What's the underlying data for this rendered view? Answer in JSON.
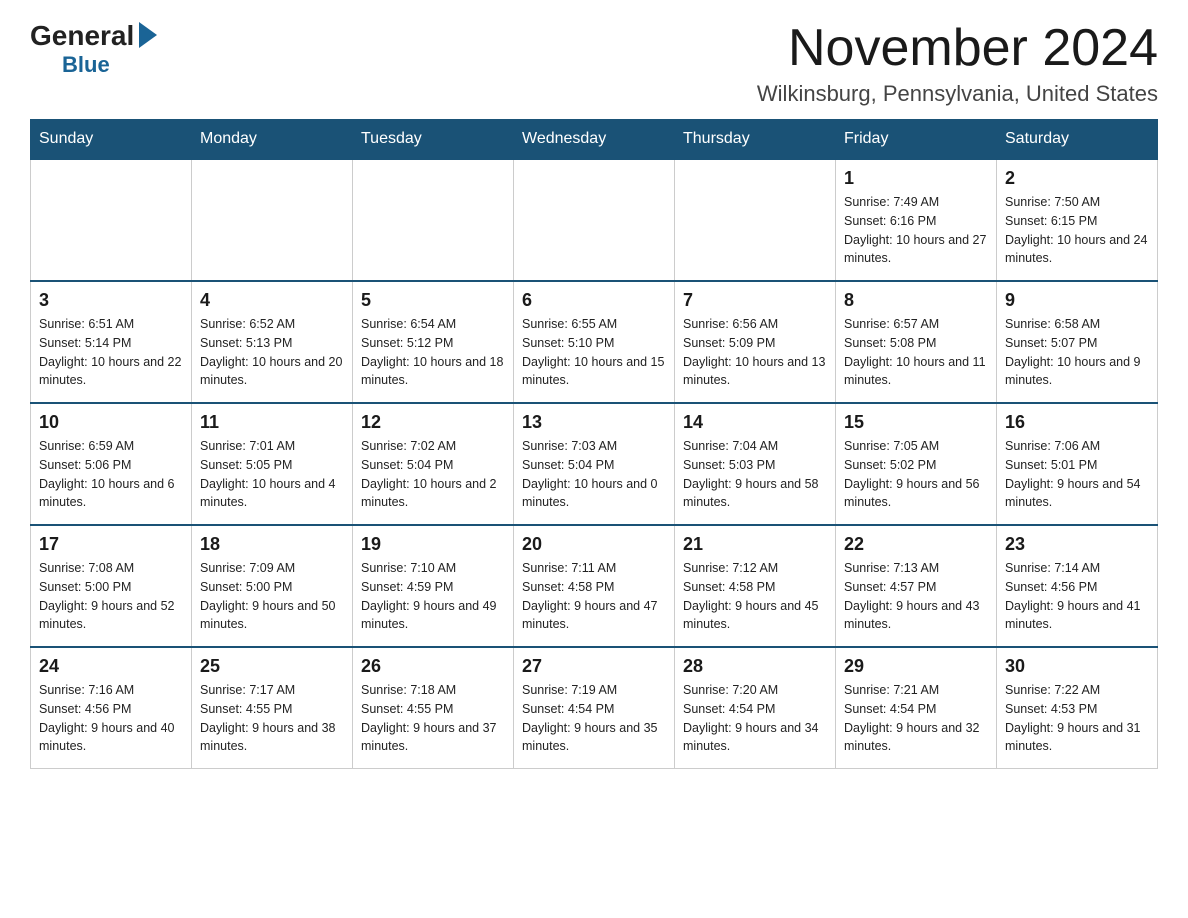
{
  "header": {
    "logo_text_general": "General",
    "logo_text_blue": "Blue",
    "month_year": "November 2024",
    "location": "Wilkinsburg, Pennsylvania, United States"
  },
  "weekdays": [
    "Sunday",
    "Monday",
    "Tuesday",
    "Wednesday",
    "Thursday",
    "Friday",
    "Saturday"
  ],
  "weeks": [
    [
      {
        "day": "",
        "info": ""
      },
      {
        "day": "",
        "info": ""
      },
      {
        "day": "",
        "info": ""
      },
      {
        "day": "",
        "info": ""
      },
      {
        "day": "",
        "info": ""
      },
      {
        "day": "1",
        "info": "Sunrise: 7:49 AM\nSunset: 6:16 PM\nDaylight: 10 hours and 27 minutes."
      },
      {
        "day": "2",
        "info": "Sunrise: 7:50 AM\nSunset: 6:15 PM\nDaylight: 10 hours and 24 minutes."
      }
    ],
    [
      {
        "day": "3",
        "info": "Sunrise: 6:51 AM\nSunset: 5:14 PM\nDaylight: 10 hours and 22 minutes."
      },
      {
        "day": "4",
        "info": "Sunrise: 6:52 AM\nSunset: 5:13 PM\nDaylight: 10 hours and 20 minutes."
      },
      {
        "day": "5",
        "info": "Sunrise: 6:54 AM\nSunset: 5:12 PM\nDaylight: 10 hours and 18 minutes."
      },
      {
        "day": "6",
        "info": "Sunrise: 6:55 AM\nSunset: 5:10 PM\nDaylight: 10 hours and 15 minutes."
      },
      {
        "day": "7",
        "info": "Sunrise: 6:56 AM\nSunset: 5:09 PM\nDaylight: 10 hours and 13 minutes."
      },
      {
        "day": "8",
        "info": "Sunrise: 6:57 AM\nSunset: 5:08 PM\nDaylight: 10 hours and 11 minutes."
      },
      {
        "day": "9",
        "info": "Sunrise: 6:58 AM\nSunset: 5:07 PM\nDaylight: 10 hours and 9 minutes."
      }
    ],
    [
      {
        "day": "10",
        "info": "Sunrise: 6:59 AM\nSunset: 5:06 PM\nDaylight: 10 hours and 6 minutes."
      },
      {
        "day": "11",
        "info": "Sunrise: 7:01 AM\nSunset: 5:05 PM\nDaylight: 10 hours and 4 minutes."
      },
      {
        "day": "12",
        "info": "Sunrise: 7:02 AM\nSunset: 5:04 PM\nDaylight: 10 hours and 2 minutes."
      },
      {
        "day": "13",
        "info": "Sunrise: 7:03 AM\nSunset: 5:04 PM\nDaylight: 10 hours and 0 minutes."
      },
      {
        "day": "14",
        "info": "Sunrise: 7:04 AM\nSunset: 5:03 PM\nDaylight: 9 hours and 58 minutes."
      },
      {
        "day": "15",
        "info": "Sunrise: 7:05 AM\nSunset: 5:02 PM\nDaylight: 9 hours and 56 minutes."
      },
      {
        "day": "16",
        "info": "Sunrise: 7:06 AM\nSunset: 5:01 PM\nDaylight: 9 hours and 54 minutes."
      }
    ],
    [
      {
        "day": "17",
        "info": "Sunrise: 7:08 AM\nSunset: 5:00 PM\nDaylight: 9 hours and 52 minutes."
      },
      {
        "day": "18",
        "info": "Sunrise: 7:09 AM\nSunset: 5:00 PM\nDaylight: 9 hours and 50 minutes."
      },
      {
        "day": "19",
        "info": "Sunrise: 7:10 AM\nSunset: 4:59 PM\nDaylight: 9 hours and 49 minutes."
      },
      {
        "day": "20",
        "info": "Sunrise: 7:11 AM\nSunset: 4:58 PM\nDaylight: 9 hours and 47 minutes."
      },
      {
        "day": "21",
        "info": "Sunrise: 7:12 AM\nSunset: 4:58 PM\nDaylight: 9 hours and 45 minutes."
      },
      {
        "day": "22",
        "info": "Sunrise: 7:13 AM\nSunset: 4:57 PM\nDaylight: 9 hours and 43 minutes."
      },
      {
        "day": "23",
        "info": "Sunrise: 7:14 AM\nSunset: 4:56 PM\nDaylight: 9 hours and 41 minutes."
      }
    ],
    [
      {
        "day": "24",
        "info": "Sunrise: 7:16 AM\nSunset: 4:56 PM\nDaylight: 9 hours and 40 minutes."
      },
      {
        "day": "25",
        "info": "Sunrise: 7:17 AM\nSunset: 4:55 PM\nDaylight: 9 hours and 38 minutes."
      },
      {
        "day": "26",
        "info": "Sunrise: 7:18 AM\nSunset: 4:55 PM\nDaylight: 9 hours and 37 minutes."
      },
      {
        "day": "27",
        "info": "Sunrise: 7:19 AM\nSunset: 4:54 PM\nDaylight: 9 hours and 35 minutes."
      },
      {
        "day": "28",
        "info": "Sunrise: 7:20 AM\nSunset: 4:54 PM\nDaylight: 9 hours and 34 minutes."
      },
      {
        "day": "29",
        "info": "Sunrise: 7:21 AM\nSunset: 4:54 PM\nDaylight: 9 hours and 32 minutes."
      },
      {
        "day": "30",
        "info": "Sunrise: 7:22 AM\nSunset: 4:53 PM\nDaylight: 9 hours and 31 minutes."
      }
    ]
  ]
}
